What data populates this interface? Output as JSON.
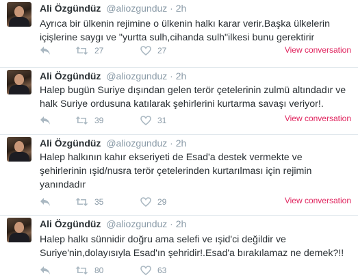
{
  "tweets": [
    {
      "name": "Ali Özgündüz",
      "handle": "@aliozgunduz",
      "separator": "·",
      "time": "2h",
      "text": "Ayrıca bir ülkenin rejimine o ülkenin halkı karar verir.Başka ülkelerin\niçişlerine saygı ve \"yurtta sulh,cihanda sulh\"ilkesi bunu gerektirir",
      "retweets": "27",
      "likes": "27",
      "view_conversation": "View conversation"
    },
    {
      "name": "Ali Özgündüz",
      "handle": "@aliozgunduz",
      "separator": "·",
      "time": "2h",
      "text": "Halep bugün Suriye dışından gelen terör çetelerinin zulmü altındadır ve\nhalk Suriye ordusuna katılarak şehirlerini kurtarma savaşı veriyor!.",
      "retweets": "39",
      "likes": "31",
      "view_conversation": "View conversation"
    },
    {
      "name": "Ali Özgündüz",
      "handle": "@aliozgunduz",
      "separator": "·",
      "time": "2h",
      "text": "Halep halkının kahır ekseriyeti de Esad'a destek vermekte ve\nşehirlerinin ışid/nusra terör çetelerinden kurtarılması için rejimin\nyanındadır",
      "retweets": "35",
      "likes": "29",
      "view_conversation": "View conversation"
    },
    {
      "name": "Ali Özgündüz",
      "handle": "@aliozgunduz",
      "separator": "·",
      "time": "2h",
      "text": "Halep halkı sünnidir doğru ama selefi ve ışid'ci değildir ve\nSuriye'nin,dolayısıyla Esad'ın şehridir!.Esad'a bırakılamaz ne demek?!!",
      "retweets": "80",
      "likes": "63",
      "view_conversation": ""
    }
  ],
  "icons": {
    "reply": "reply-icon",
    "retweet": "retweet-icon",
    "like": "heart-icon"
  },
  "colors": {
    "name": "#292f33",
    "meta": "#8899a6",
    "icon": "#aab8c2",
    "link": "#e0245e",
    "divider": "#e1e8ed"
  }
}
